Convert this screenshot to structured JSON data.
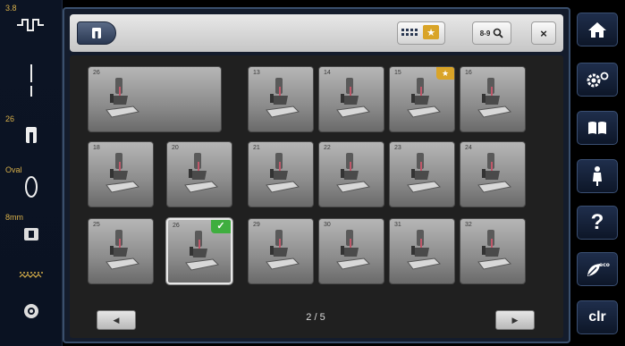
{
  "left_bar": {
    "top_value": "3.8",
    "stitch_width_value": "26",
    "needle_label": "Oval",
    "thread_label": "8mm"
  },
  "toolbar": {
    "foot_label_icon": "presser-foot-icon",
    "search_label": "8-9",
    "close_label": "×"
  },
  "feet": [
    {
      "num": "26",
      "favorite": false,
      "selected": false
    },
    {
      "num": "13",
      "favorite": false,
      "selected": false
    },
    {
      "num": "14",
      "favorite": false,
      "selected": false
    },
    {
      "num": "15",
      "favorite": true,
      "selected": false
    },
    {
      "num": "16",
      "favorite": false,
      "selected": false
    },
    {
      "num": "18",
      "favorite": false,
      "selected": false
    },
    {
      "num": "20",
      "favorite": false,
      "selected": false
    },
    {
      "num": "21",
      "favorite": false,
      "selected": false
    },
    {
      "num": "22",
      "favorite": false,
      "selected": false
    },
    {
      "num": "23",
      "favorite": false,
      "selected": false
    },
    {
      "num": "24",
      "favorite": false,
      "selected": false
    },
    {
      "num": "25",
      "favorite": false,
      "selected": false
    },
    {
      "num": "26",
      "favorite": false,
      "selected": true
    },
    {
      "num": "29",
      "favorite": false,
      "selected": false
    },
    {
      "num": "30",
      "favorite": false,
      "selected": false
    },
    {
      "num": "31",
      "favorite": false,
      "selected": false
    },
    {
      "num": "32",
      "favorite": false,
      "selected": false
    }
  ],
  "pager": {
    "text": "2 / 5"
  },
  "right_bar": {
    "clr_label": "clr",
    "help_label": "?"
  },
  "colors": {
    "accent": "#d9a428",
    "selected_check": "#3fae3f",
    "panel": "#202020"
  }
}
